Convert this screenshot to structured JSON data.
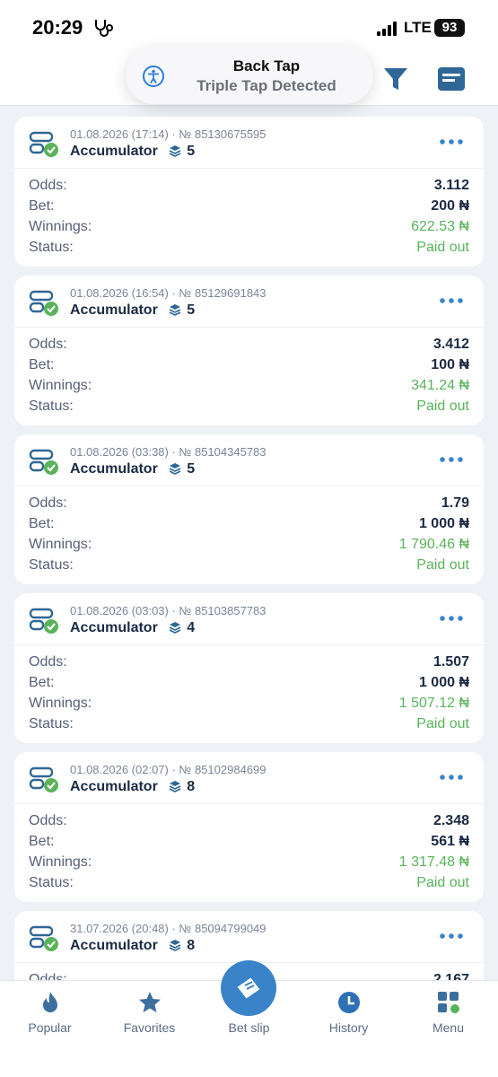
{
  "status_bar": {
    "time": "20:29",
    "network": "LTE",
    "battery": "93"
  },
  "toast": {
    "title": "Back Tap",
    "subtitle": "Triple Tap Detected"
  },
  "labels": {
    "odds": "Odds:",
    "bet": "Bet:",
    "winnings": "Winnings:",
    "status": "Status:"
  },
  "bets": [
    {
      "meta": "01.08.2026 (17:14) · № 85130675595",
      "type": "Accumulator",
      "count": "5",
      "odds": "3.112",
      "bet": "200 ₦",
      "winnings": "622.53 ₦",
      "status": "Paid out"
    },
    {
      "meta": "01.08.2026 (16:54) · № 85129691843",
      "type": "Accumulator",
      "count": "5",
      "odds": "3.412",
      "bet": "100 ₦",
      "winnings": "341.24 ₦",
      "status": "Paid out"
    },
    {
      "meta": "01.08.2026 (03:38) · № 85104345783",
      "type": "Accumulator",
      "count": "5",
      "odds": "1.79",
      "bet": "1 000 ₦",
      "winnings": "1 790.46 ₦",
      "status": "Paid out"
    },
    {
      "meta": "01.08.2026 (03:03) · № 85103857783",
      "type": "Accumulator",
      "count": "4",
      "odds": "1.507",
      "bet": "1 000 ₦",
      "winnings": "1 507.12 ₦",
      "status": "Paid out"
    },
    {
      "meta": "01.08.2026 (02:07) · № 85102984699",
      "type": "Accumulator",
      "count": "8",
      "odds": "2.348",
      "bet": "561 ₦",
      "winnings": "1 317.48 ₦",
      "status": "Paid out"
    },
    {
      "meta": "31.07.2026 (20:48) · № 85094799049",
      "type": "Accumulator",
      "count": "8",
      "odds": "2.167",
      "bet": "",
      "winnings": "",
      "status": ""
    }
  ],
  "nav": {
    "popular": "Popular",
    "favorites": "Favorites",
    "betslip": "Bet slip",
    "history": "History",
    "menu": "Menu"
  },
  "colors": {
    "accent": "#3a83c9",
    "win": "#59b35a",
    "text": "#1b2a44"
  }
}
